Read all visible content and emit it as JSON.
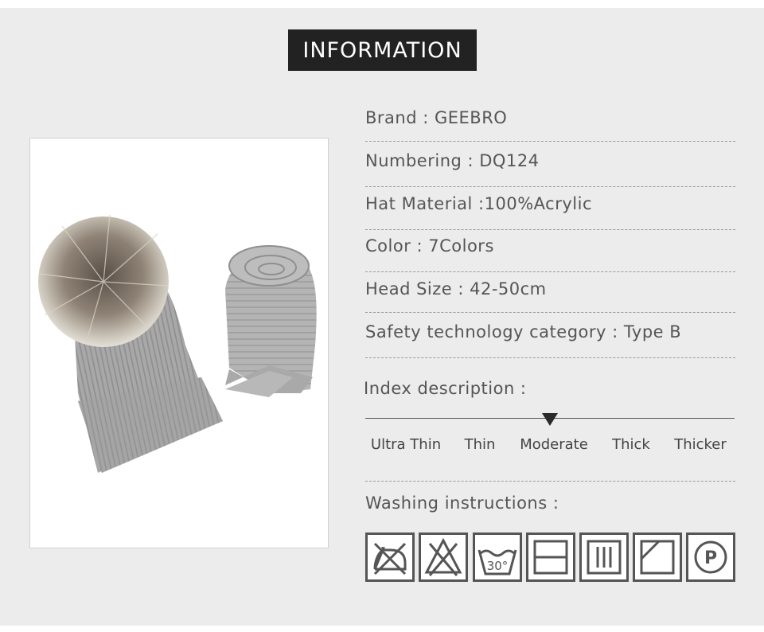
{
  "header": {
    "title": "INFORMATION"
  },
  "info": {
    "brand": "Brand : GEEBRO",
    "numbering": "Numbering : DQ124",
    "material": "Hat Material :100%Acrylic",
    "color": "Color : 7Colors",
    "head_size": "Head Size : 42-50cm",
    "safety": "Safety technology category : Type B"
  },
  "index": {
    "label": "Index description :",
    "options": [
      "Ultra Thin",
      "Thin",
      "Moderate",
      "Thick",
      "Thicker"
    ],
    "selected": "Moderate"
  },
  "washing": {
    "label": "Washing instructions :",
    "icons": [
      "do-not-iron-icon",
      "do-not-bleach-icon",
      "wash-30-icon",
      "dry-flat-icon",
      "drip-dry-icon",
      "dry-in-shade-icon",
      "professional-dry-clean-p-icon"
    ],
    "wash_temp": "30°",
    "dry_clean_letter": "P"
  },
  "photo": {
    "subject": "grey knit beanie with fur pom-pom and matching scarf",
    "colors": {
      "knit": "#a9a9a9",
      "fur": "#8f8578",
      "background": "#ffffff"
    }
  }
}
